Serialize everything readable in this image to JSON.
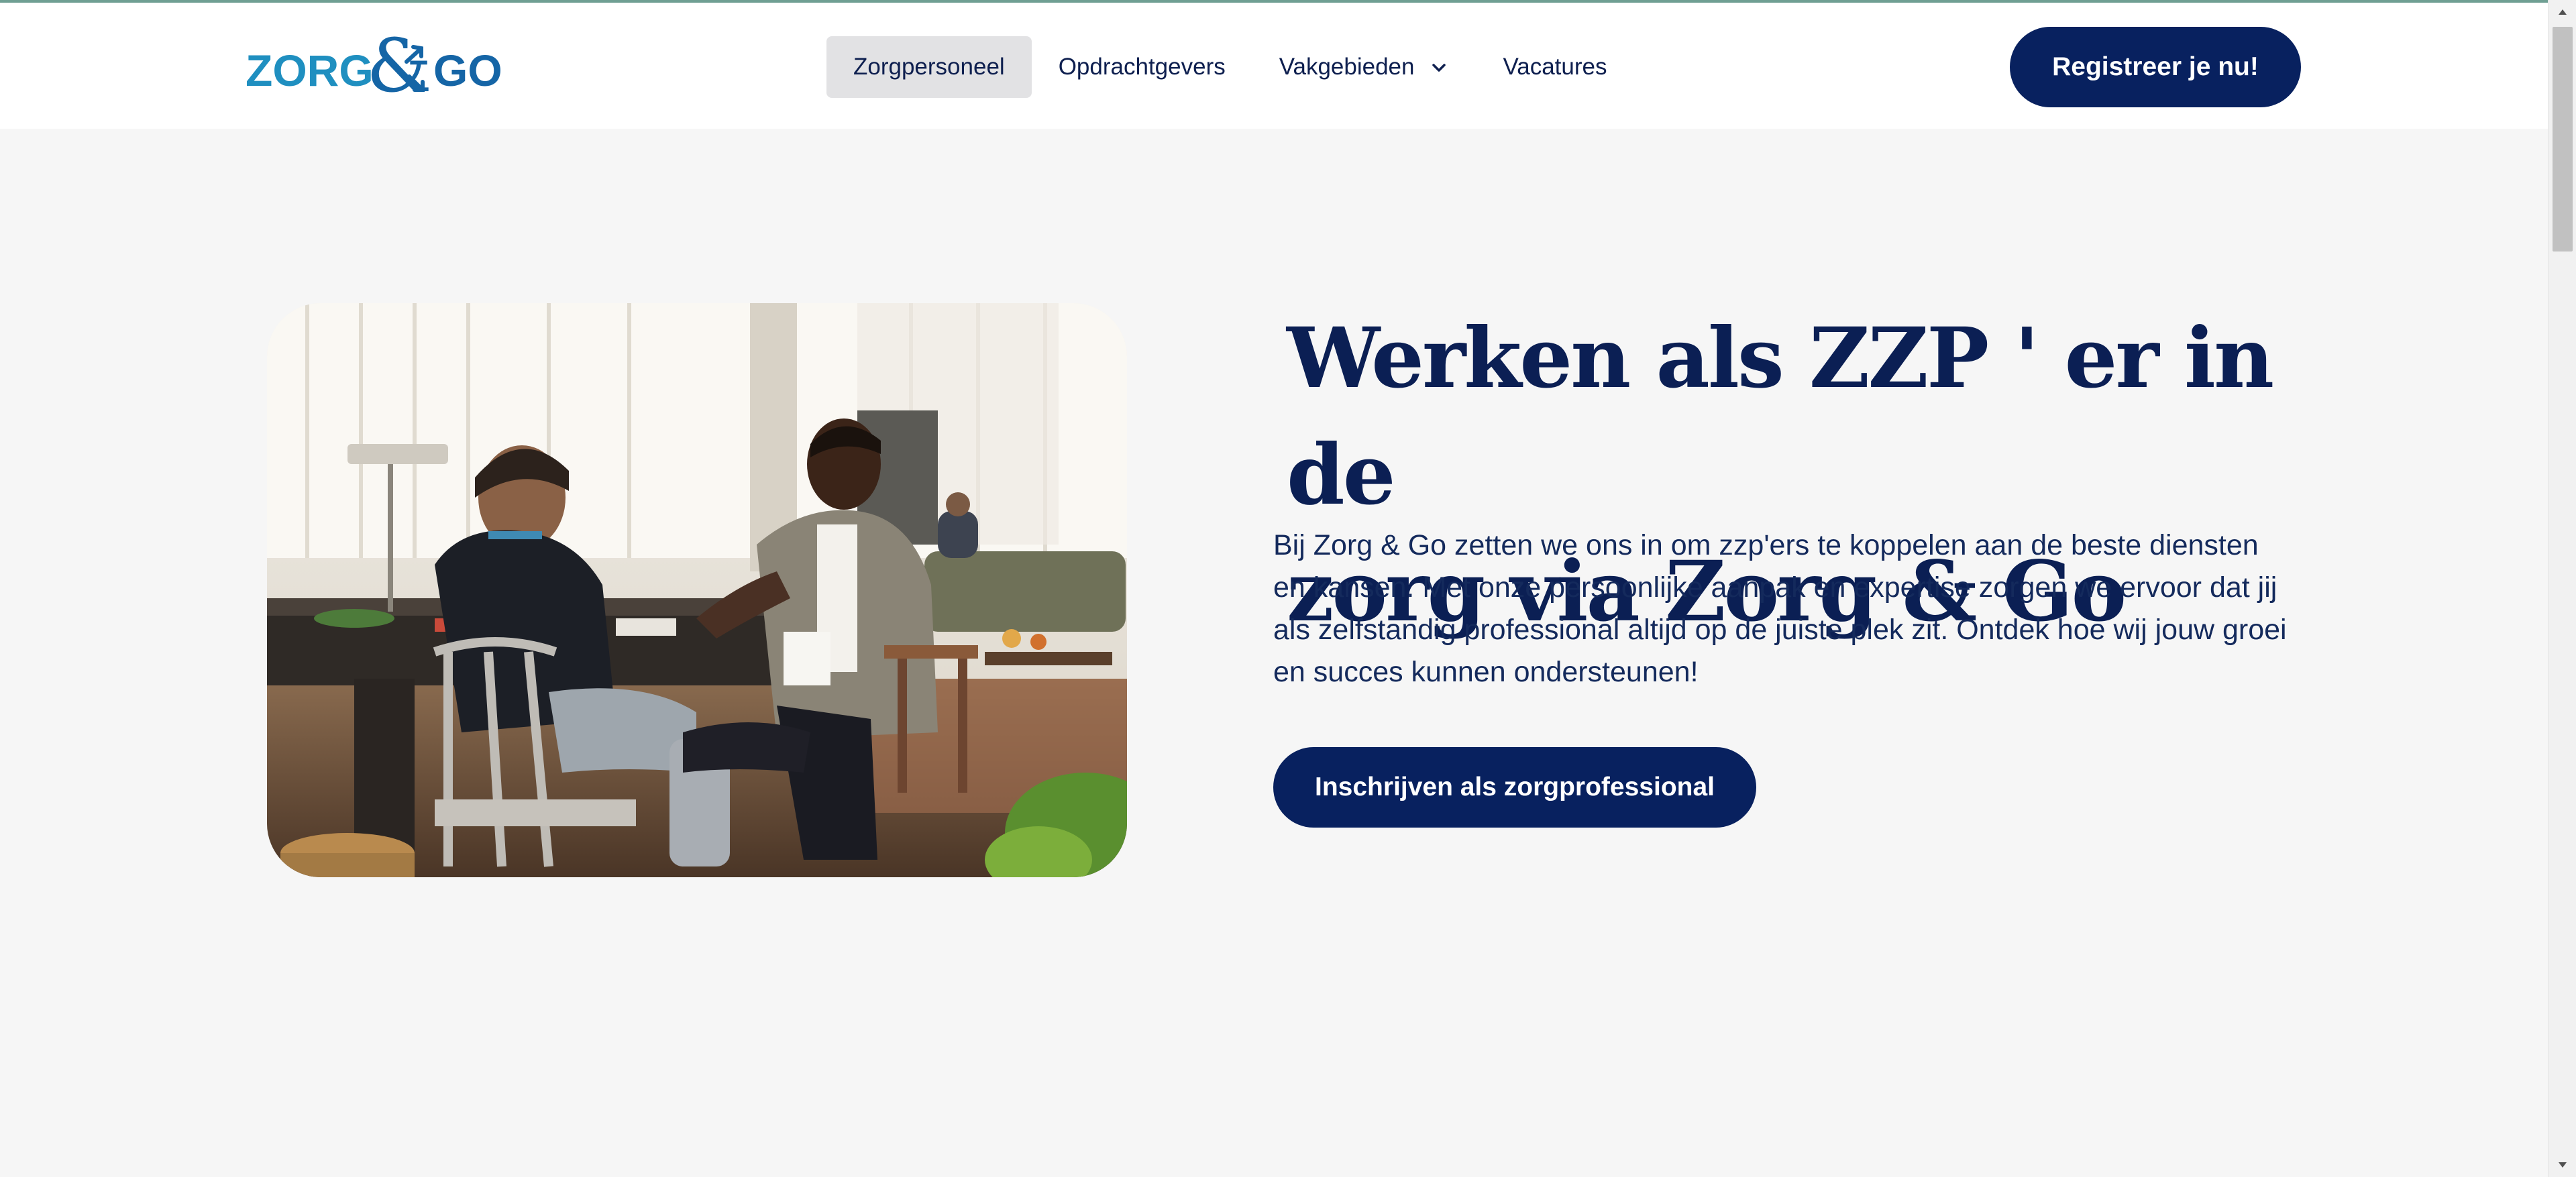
{
  "header": {
    "logo_alt": "ZORG & GO",
    "logo_left": "ZORG",
    "logo_amp": "&",
    "logo_right": "GO",
    "nav": [
      {
        "label": "Zorgpersoneel",
        "active": true
      },
      {
        "label": "Opdrachtgevers",
        "active": false
      },
      {
        "label": "Vakgebieden",
        "active": false,
        "dropdown": true
      },
      {
        "label": "Vacatures",
        "active": false
      }
    ],
    "cta_label": "Registreer je nu!"
  },
  "hero": {
    "title_line1": "Werken als ZZP ' er in de",
    "title_line2": "zorg via Zorg & Go",
    "body": "Bij Zorg & Go zetten we ons in om zzp'ers te koppelen aan de beste diensten en kansen. Met onze persoonlijke aanpak en expertise zorgen we ervoor dat jij als zelfstandig professional altijd op de juiste plek zit. Ontdek hoe wij jouw groei en succes kunnen ondersteunen!",
    "button_label": "Inschrijven als zorgprofessional"
  },
  "colors": {
    "navy": "#08215f",
    "title": "#0b1f54",
    "logo_teal": "#1f8fc0",
    "logo_blue": "#1565a6",
    "nav_active_bg": "#e2e2e4",
    "page_bg": "#f6f6f6"
  },
  "icons": {
    "dropdown": "chevron-down-icon",
    "scroll_up": "scroll-up-arrow-icon",
    "scroll_down": "scroll-down-arrow-icon"
  }
}
